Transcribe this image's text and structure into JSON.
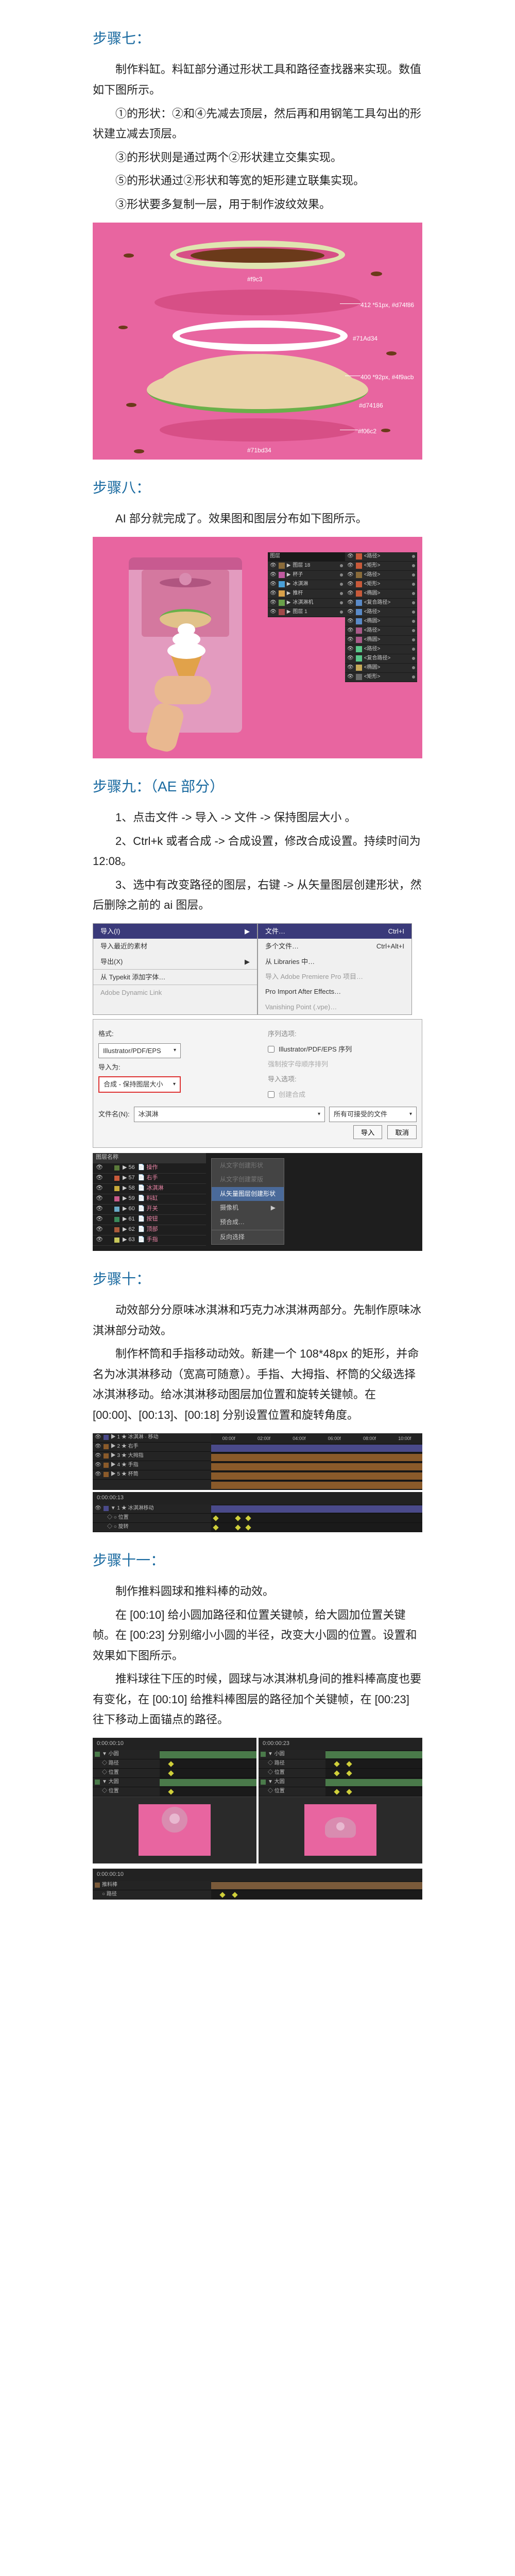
{
  "step7": {
    "title": "步骤七：",
    "p1": "制作料缸。料缸部分通过形状工具和路径查找器来实现。数值如下图所示。",
    "p2": "①的形状：②和④先减去顶层，然后再和用钢笔工具勾出的形状建立减去顶层。",
    "p3": "③的形状则是通过两个②形状建立交集实现。",
    "p4": "⑤的形状通过②形状和等宽的矩形建立联集实现。",
    "p5": "③形状要多复制一层，用于制作波纹效果。",
    "labels": [
      "#f9c3",
      "412 *51px, #d74f86",
      "#71Ad34",
      "400 *92px, #4f9acb",
      "#d74186",
      "#f06c2",
      "#71bd34"
    ]
  },
  "step8": {
    "title": "步骤八：",
    "p1": "AI 部分就完成了。效果图和图层分布如下图所示。",
    "panel1_header": "图层",
    "panel1_rows": [
      {
        "c": "#8a6b3a",
        "t": "图层 18"
      },
      {
        "c": "#c05aa0",
        "t": "杯子"
      },
      {
        "c": "#4aa0d8",
        "t": "冰淇淋"
      },
      {
        "c": "#d8a04a",
        "t": "推杆"
      },
      {
        "c": "#6aa04a",
        "t": "冰淇淋机"
      },
      {
        "c": "#a04a4a",
        "t": "图层 1"
      }
    ],
    "panel2_rows": [
      {
        "c": "#c85a3a",
        "t": "<路径>"
      },
      {
        "c": "#c85a3a",
        "t": "<矩形>"
      },
      {
        "c": "#8a6b3a",
        "t": "<路径>"
      },
      {
        "c": "#c85a3a",
        "t": "<矩形>"
      },
      {
        "c": "#c85a3a",
        "t": "<椭圆>"
      },
      {
        "c": "#5a8ac8",
        "t": "<复合路径>"
      },
      {
        "c": "#5a8ac8",
        "t": "<路径>"
      },
      {
        "c": "#5a8ac8",
        "t": "<椭圆>"
      },
      {
        "c": "#aa5a8a",
        "t": "<路径>"
      },
      {
        "c": "#aa5a8a",
        "t": "<椭圆>"
      },
      {
        "c": "#5ac88a",
        "t": "<路径>"
      },
      {
        "c": "#5ac88a",
        "t": "<复合路径>"
      },
      {
        "c": "#c8aa5a",
        "t": "<椭圆>"
      },
      {
        "c": "#6a6a6a",
        "t": "<矩形>"
      }
    ]
  },
  "step9": {
    "title": "步骤九：（AE 部分）",
    "p1": "1、点击文件 -> 导入 -> 文件 -> 保持图层大小 。",
    "p2": "2、Ctrl+k 或者合成 -> 合成设置，修改合成设置。持续时间为 12:08。",
    "p3": "3、选中有改变路径的图层，右键 -> 从矢量图层创建形状，然后删除之前的 ai 图层。",
    "import_menu": {
      "header": "导入(I)",
      "items": [
        "导入最近的素材",
        "导出(X)",
        "从 Typekit 添加字体…",
        "Adobe Dynamic Link"
      ],
      "sub": [
        "文件…",
        "多个文件…",
        "从 Libraries 中…",
        "导入 Adobe Premiere Pro 项目…",
        "Pro Import After Effects…",
        "Vanishing Point (.vpe)…"
      ],
      "shortcuts": [
        "Ctrl+I",
        "Ctrl+Alt+I"
      ]
    },
    "dialog": {
      "format_label": "格式:",
      "format_value": "Illustrator/PDF/EPS",
      "import_as_label": "导入为:",
      "import_as_value": "合成 - 保持图层大小",
      "seq_opt_header": "序列选项:",
      "seq_checkbox": "Illustrator/PDF/EPS 序列",
      "seq_force": "强制按字母顺序排列",
      "import_opt_header": "导入选项:",
      "create_comp": "创建合成",
      "filename_label": "文件名(N):",
      "filename_value": "冰淇淋",
      "filter": "所有可接受的文件",
      "import_btn": "导入",
      "cancel_btn": "取消"
    },
    "ae_layers": {
      "header": "图层名称",
      "rows": [
        "操作",
        "右手",
        "冰淇淋",
        "料缸",
        "开关",
        "按钮",
        "顶部",
        "手指"
      ],
      "ctx": [
        "从文字创建形状",
        "从文字创建蒙版",
        "从矢量图层创建形状",
        "摄像机",
        "预合成…",
        "反向选择"
      ]
    }
  },
  "step10": {
    "title": "步骤十：",
    "p1": "动效部分分原味冰淇淋和巧克力冰淇淋两部分。先制作原味冰淇淋部分动效。",
    "p2": "制作杯筒和手指移动动效。新建一个 108*48px 的矩形，并命名为冰淇淋移动（宽高可随意）。手指、大拇指、杯筒的父级选择冰淇淋移动。给冰淇淋移动图层加位置和旋转关键帧。在 [00:00]、[00:13]、[00:18] 分别设置位置和旋转角度。",
    "tl1_rows": [
      "冰淇淋 · 移动",
      "右手",
      "大拇指",
      "手指",
      "杯筒"
    ],
    "tl2_rows": [
      "冰淇淋移动",
      "○ 位置",
      "○ 旋转"
    ],
    "times": [
      "00:00f",
      "02:00f",
      "04:00f",
      "06:00f",
      "08:00f",
      "10:00f"
    ]
  },
  "step11": {
    "title": "步骤十一：",
    "p1": "制作推料圆球和推料棒的动效。",
    "p2": "在 [00:10] 给小圆加路径和位置关键帧，给大圆加位置关键帧。在 [00:23] 分别缩小小圆的半径，改变大小圆的位置。设置和效果如下图所示。",
    "p3": "推料球往下压的时候，圆球与冰淇淋机身间的推料棒高度也要有变化，在 [00:10] 给推料棒图层的路径加个关键帧，在 [00:23] 往下移动上面锚点的路径。",
    "tl_rows": [
      "小圆",
      "○ 路径",
      "○ 位置",
      "大圆",
      "○ 位置"
    ],
    "time_a": "0:00:00:10",
    "time_b": "0:00:00:23"
  }
}
